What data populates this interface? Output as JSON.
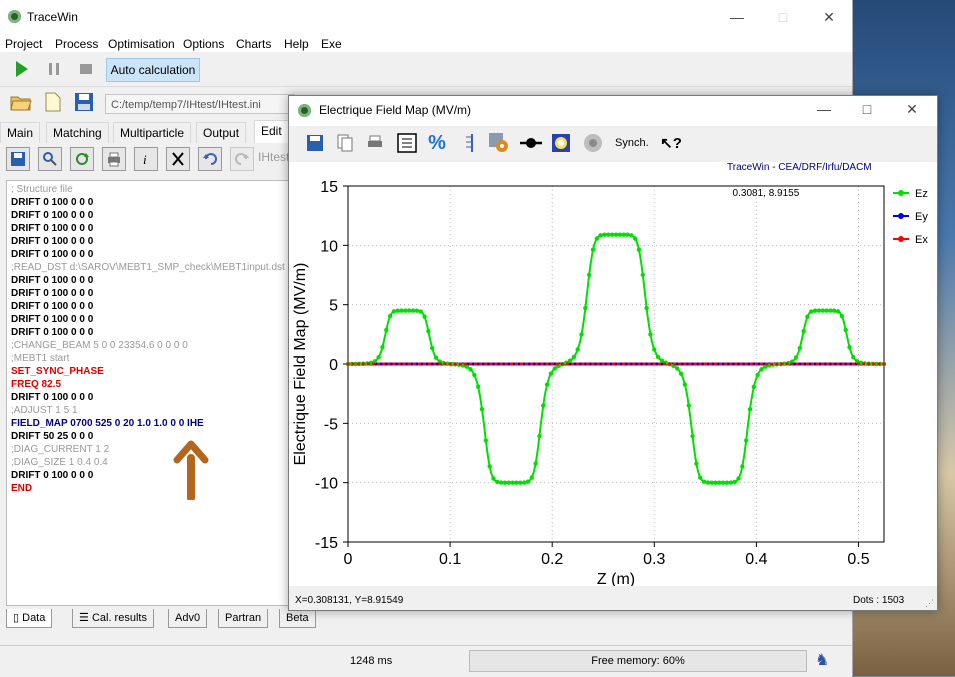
{
  "main_window": {
    "title": "TraceWin",
    "controls": {
      "minimize": "—",
      "maximize": "□",
      "close": "✕"
    },
    "menu": [
      "Project",
      "Process",
      "Optimisation",
      "Options",
      "Charts",
      "Help",
      "Exe"
    ],
    "toolbar": {
      "auto_calc_label": "Auto calculation",
      "path": "C:/temp/temp7/IHtest/IHtest.ini"
    },
    "tabs": [
      "Main",
      "Matching",
      "Multiparticle",
      "Output",
      "Edit"
    ],
    "edit_toolbar_label": "IHtest",
    "editor_lines": [
      {
        "text": "; Structure file",
        "style": "comment"
      },
      {
        "text": "DRIFT 0 100 0 0 0",
        "style": "normal"
      },
      {
        "text": "DRIFT 0 100 0 0 0",
        "style": "normal"
      },
      {
        "text": "DRIFT 0 100 0 0 0",
        "style": "normal"
      },
      {
        "text": "DRIFT 0 100 0 0 0",
        "style": "normal"
      },
      {
        "text": "DRIFT 0 100 0 0 0",
        "style": "normal"
      },
      {
        "text": ";READ_DST d:\\SAROV\\MEBT1_SMP_check\\MEBT1input.dst",
        "style": "comment"
      },
      {
        "text": "DRIFT 0 100 0 0 0",
        "style": "normal"
      },
      {
        "text": "DRIFT 0 100 0 0 0",
        "style": "normal"
      },
      {
        "text": "DRIFT 0 100 0 0 0",
        "style": "normal"
      },
      {
        "text": "DRIFT 0 100 0 0 0",
        "style": "normal"
      },
      {
        "text": "DRIFT 0 100 0 0 0",
        "style": "normal"
      },
      {
        "text": ";CHANGE_BEAM 5 0 0 23354.6 0 0 0 0",
        "style": "comment"
      },
      {
        "text": ";MEBT1 start",
        "style": "comment"
      },
      {
        "text": "SET_SYNC_PHASE",
        "style": "red"
      },
      {
        "text": "FREQ 82.5",
        "style": "red"
      },
      {
        "text": "DRIFT 0 100 0 0 0",
        "style": "normal"
      },
      {
        "text": ";ADJUST 1 5 1",
        "style": "comment"
      },
      {
        "text": "FIELD_MAP 0700 525 0 20 1.0 1.0 0 0 IHE",
        "style": "blue"
      },
      {
        "text": "DRIFT 50 25 0 0 0",
        "style": "normal"
      },
      {
        "text": ";DIAG_CURRENT 1 2",
        "style": "comment"
      },
      {
        "text": ";DIAG_SIZE 1 0.4 0.4",
        "style": "comment"
      },
      {
        "text": "DRIFT 0 100 0 0 0",
        "style": "normal"
      },
      {
        "text": "END",
        "style": "red"
      }
    ],
    "bottom_tabs": [
      "Data",
      "Cal. results",
      "Adv0",
      "Partran",
      "Beta"
    ],
    "status": {
      "time": "1248 ms",
      "memory": "Free memory: 60%",
      "memory_fraction": 0.6
    }
  },
  "chart_window": {
    "title": "Electrique Field Map (MV/m)",
    "controls": {
      "minimize": "—",
      "maximize": "□",
      "close": "✕"
    },
    "synch_label": "Synch.",
    "credit": "TraceWin - CEA/DRF/Irfu/DACM",
    "cursor_label": "0.3081, 8.9155",
    "status": {
      "coords": "X=0.308131, Y=8.91549",
      "dots": "Dots : 1503"
    }
  },
  "chart_data": {
    "type": "line",
    "xlabel": "Z (m)",
    "ylabel": "Electrique Field Map (MV/m)",
    "xlim": [
      0,
      0.525
    ],
    "ylim": [
      -15,
      15
    ],
    "xticks": [
      0,
      0.1,
      0.2,
      0.3,
      0.4,
      0.5
    ],
    "yticks": [
      -15,
      -10,
      -5,
      0,
      5,
      10,
      15
    ],
    "grid": true,
    "legend": "right",
    "series": [
      {
        "name": "Ez",
        "color": "#00e000",
        "pulses": [
          {
            "center": 0.058,
            "amplitude": 4.5,
            "half_width": 0.022
          },
          {
            "center": 0.161,
            "amplitude": -10.0,
            "half_width": 0.028
          },
          {
            "center": 0.2625,
            "amplitude": 10.9,
            "half_width": 0.029
          },
          {
            "center": 0.364,
            "amplitude": -10.0,
            "half_width": 0.028
          },
          {
            "center": 0.467,
            "amplitude": 4.5,
            "half_width": 0.022
          }
        ]
      },
      {
        "name": "Ey",
        "color": "#0000dd",
        "values": 0
      },
      {
        "name": "Ex",
        "color": "#ff0000",
        "values": 0
      }
    ]
  }
}
